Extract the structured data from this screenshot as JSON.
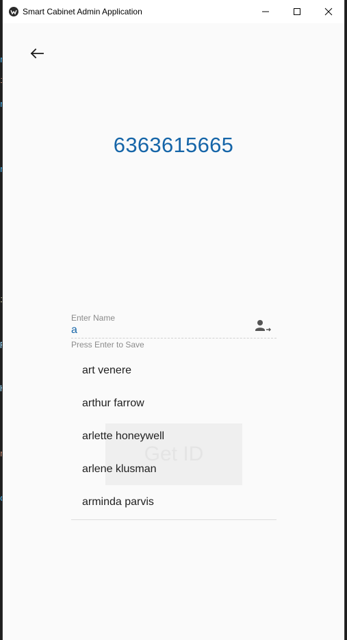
{
  "window": {
    "title": "Smart Cabinet Admin Application"
  },
  "phone_number": "6363615665",
  "ghost_text": "Get ID",
  "name_field": {
    "label": "Enter Name",
    "value": "a",
    "helper": "Press Enter to Save",
    "icon": "person-arrow-icon"
  },
  "suggestions": [
    "art venere",
    "arthur farrow",
    "arlette honeywell",
    "arlene klusman",
    "arminda parvis"
  ],
  "colors": {
    "accent": "#1565a8",
    "background": "#fafafa"
  }
}
